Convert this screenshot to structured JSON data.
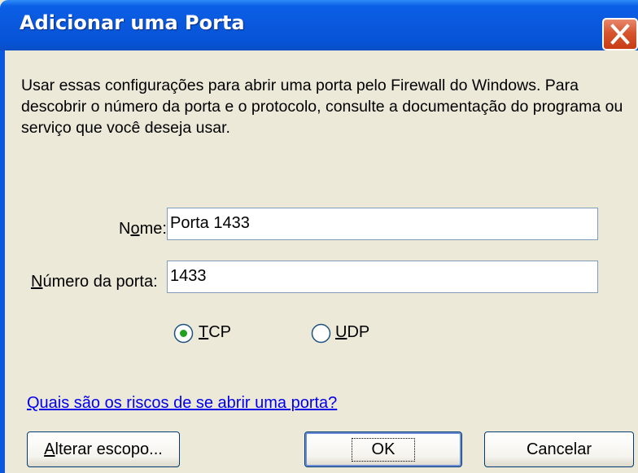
{
  "window": {
    "title": "Adicionar uma Porta",
    "close_label": "Fechar"
  },
  "description": "Usar essas configurações para abrir uma porta pelo Firewall do Windows. Para descobrir o número da porta e o protocolo, consulte a documentação do programa ou serviço que você deseja usar.",
  "name_field": {
    "label_pre": "N",
    "label_accel": "o",
    "label_post": "me:",
    "value": "Porta 1433"
  },
  "port_field": {
    "label_pre": "",
    "label_accel": "N",
    "label_post": "úmero da porta:",
    "value": "1433"
  },
  "protocol": {
    "tcp": {
      "accel": "T",
      "rest": "CP",
      "selected": true
    },
    "udp": {
      "accel": "U",
      "rest": "DP",
      "selected": false
    }
  },
  "link": "Quais são os riscos de se abrir uma porta?",
  "buttons": {
    "scope": {
      "accel": "A",
      "rest": "lterar escopo..."
    },
    "ok": "OK",
    "cancel": "Cancelar"
  },
  "colors": {
    "titlebar": "#0A58DC",
    "dialog_bg": "#ECE9D8",
    "close_button": "#D6552F",
    "link": "#0000EE",
    "input_border": "#7F9DB9"
  }
}
